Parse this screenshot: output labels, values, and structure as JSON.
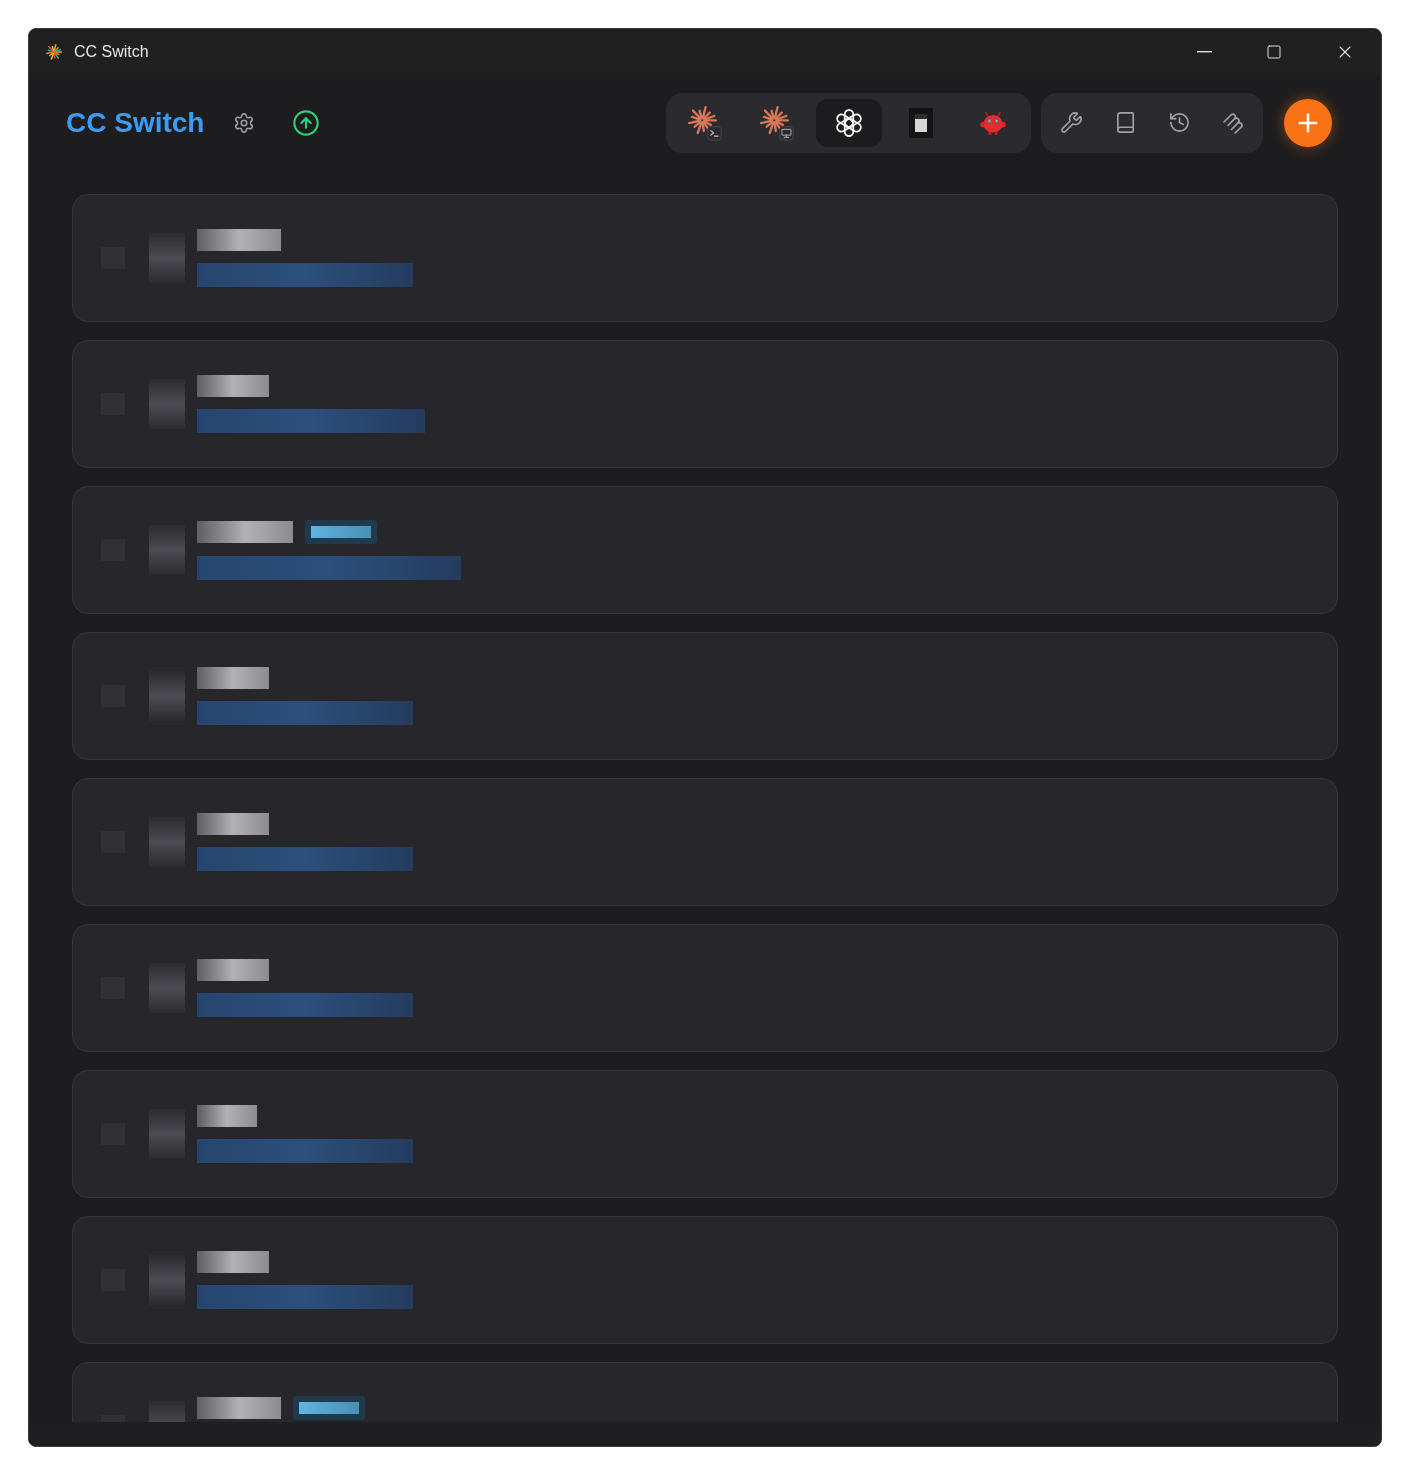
{
  "window": {
    "title": "CC Switch"
  },
  "header": {
    "title": "CC Switch",
    "update_available": true
  },
  "app_tabs": [
    {
      "selected": false
    },
    {
      "selected": false
    },
    {
      "selected": true
    },
    {
      "selected": false
    },
    {
      "selected": false
    }
  ],
  "providers": [
    {
      "badge": false
    },
    {
      "badge": false
    },
    {
      "badge": true
    },
    {
      "badge": false
    },
    {
      "badge": false
    },
    {
      "badge": false
    },
    {
      "badge": false
    },
    {
      "badge": false
    },
    {
      "badge": true
    }
  ]
}
